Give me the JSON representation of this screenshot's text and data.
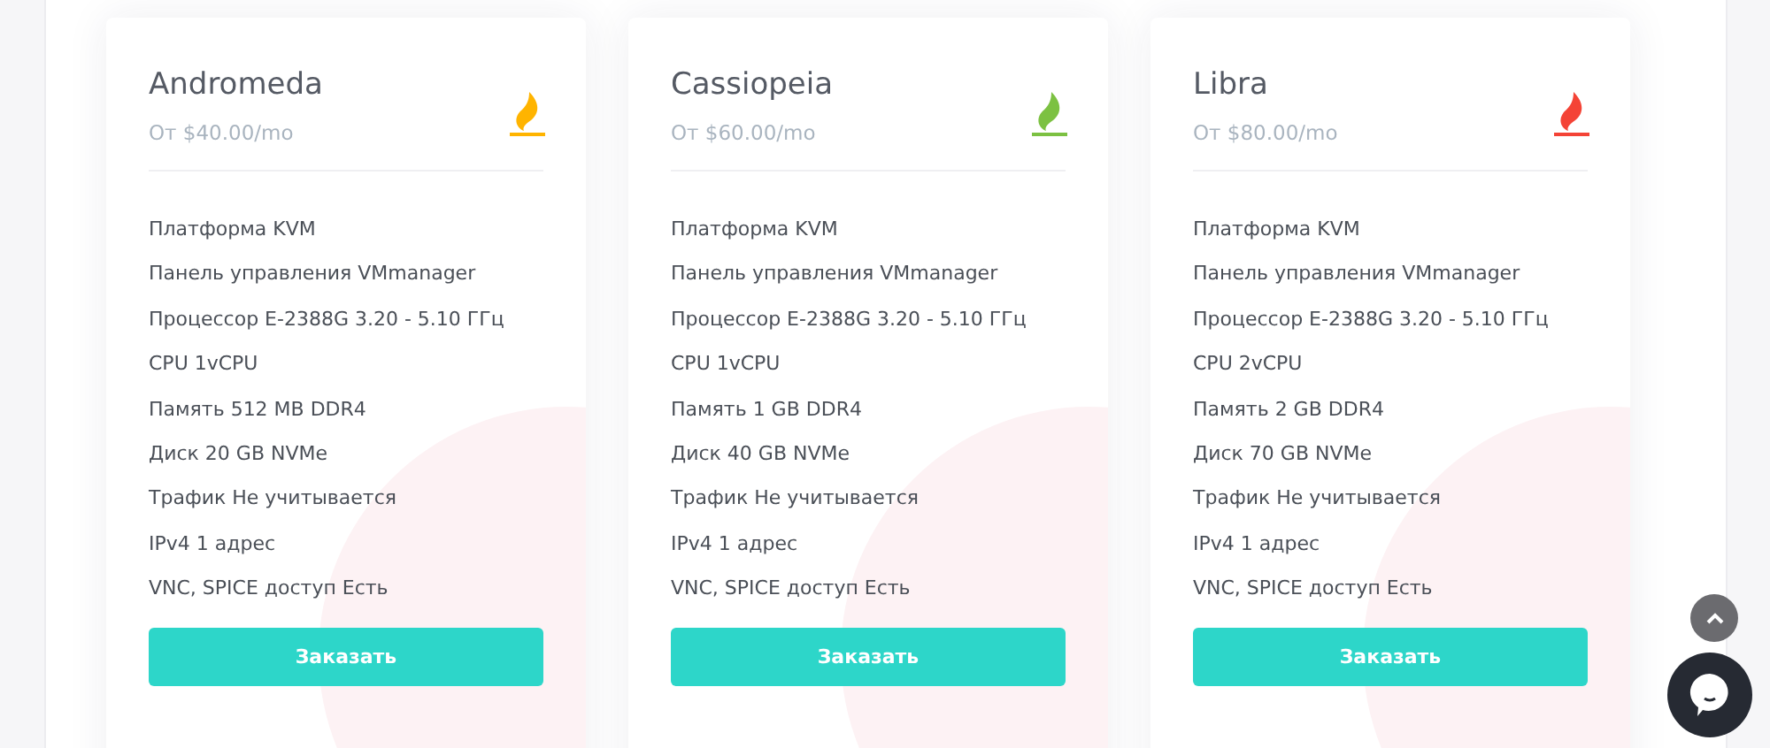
{
  "plans": [
    {
      "name": "Andromeda",
      "price": "От $40.00/mo",
      "color": "#ffb400",
      "features": [
        "Платформа KVM",
        "Панель управления VMmanager",
        "Процессор E-2388G 3.20 - 5.10 ГГц",
        "CPU 1vCPU",
        "Память 512 MB DDR4",
        "Диск 20 GB NVMe",
        "Трафик Не учитывается",
        "IPv4 1 адрес",
        "VNC, SPICE доступ Есть"
      ],
      "button": "Заказать"
    },
    {
      "name": "Cassiopeia",
      "price": "От $60.00/mo",
      "color": "#7cc142",
      "features": [
        "Платформа KVM",
        "Панель управления VMmanager",
        "Процессор E-2388G 3.20 - 5.10 ГГц",
        "CPU 1vCPU",
        "Память 1 GB DDR4",
        "Диск 40 GB NVMe",
        "Трафик Не учитывается",
        "IPv4 1 адрес",
        "VNC, SPICE доступ Есть"
      ],
      "button": "Заказать"
    },
    {
      "name": "Libra",
      "price": "От $80.00/mo",
      "color": "#f44336",
      "features": [
        "Платформа KVM",
        "Панель управления VMmanager",
        "Процессор E-2388G 3.20 - 5.10 ГГц",
        "CPU 2vCPU",
        "Память 2 GB DDR4",
        "Диск 70 GB NVMe",
        "Трафик Не учитывается",
        "IPv4 1 адрес",
        "VNC, SPICE доступ Есть"
      ],
      "button": "Заказать"
    }
  ]
}
